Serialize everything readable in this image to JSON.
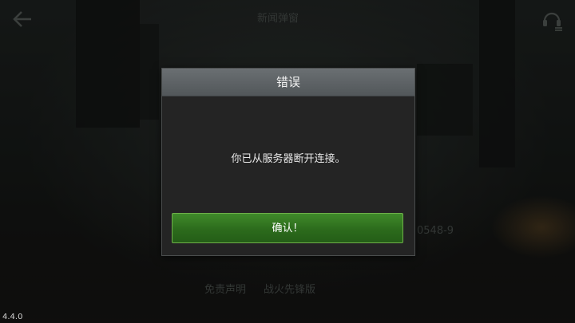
{
  "background": {
    "title_text": "新闻弹窗",
    "footer_link_1": "免责声明",
    "footer_link_2": "战火先锋版",
    "contact_suffix": "0548-9"
  },
  "dialog": {
    "title": "错误",
    "message": "你已从服务器断开连接。",
    "confirm_label": "确认！"
  },
  "icons": {
    "back": "back-arrow-icon",
    "support": "headset-icon"
  },
  "colors": {
    "confirm_green": "#2f7420",
    "header_gray": "#5e6366"
  },
  "version": "4.4.0"
}
